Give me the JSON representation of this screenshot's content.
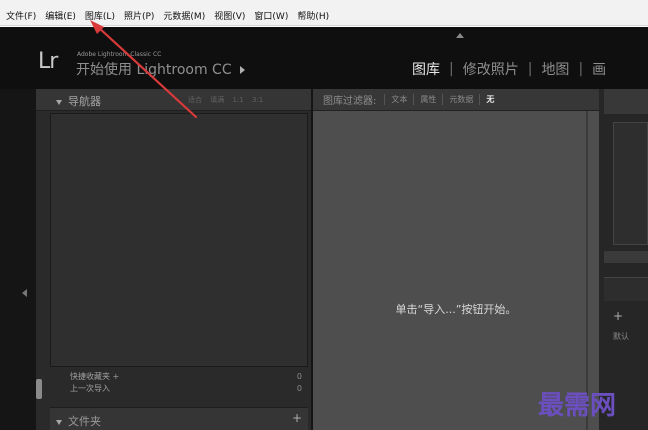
{
  "menubar": {
    "items": [
      "文件(F)",
      "编辑(E)",
      "图库(L)",
      "照片(P)",
      "元数据(M)",
      "视图(V)",
      "窗口(W)",
      "帮助(H)"
    ]
  },
  "identity": {
    "logo": "Lr",
    "product_small": "Adobe Lightroom Classic CC",
    "product_main": "开始使用 Lightroom CC"
  },
  "modules": [
    "图库",
    "修改照片",
    "地图",
    "画"
  ],
  "navigator": {
    "title": "导航器",
    "zoom_options": [
      "适合",
      "填满",
      "1:1",
      "3:1"
    ]
  },
  "collections": [
    {
      "label": "快捷收藏夹 +",
      "count": "0"
    },
    {
      "label": "上一次导入",
      "count": "0"
    }
  ],
  "folders": {
    "title": "文件夹",
    "add_label": "+"
  },
  "filter_bar": {
    "label": "图库过滤器:",
    "tabs": [
      "文本",
      "属性",
      "元数据",
      "无"
    ]
  },
  "center_message": "单击“导入...”按钮开始。",
  "right_panel": {
    "plus": "+",
    "default_label": "默认"
  },
  "watermark": "最需网",
  "colors": {
    "app_bg": "#151515",
    "panel_bg": "#2a2a2a",
    "center_bg": "#4e4e4e",
    "annotation_arrow": "#d93a3a",
    "watermark": "#6b4fbf"
  }
}
